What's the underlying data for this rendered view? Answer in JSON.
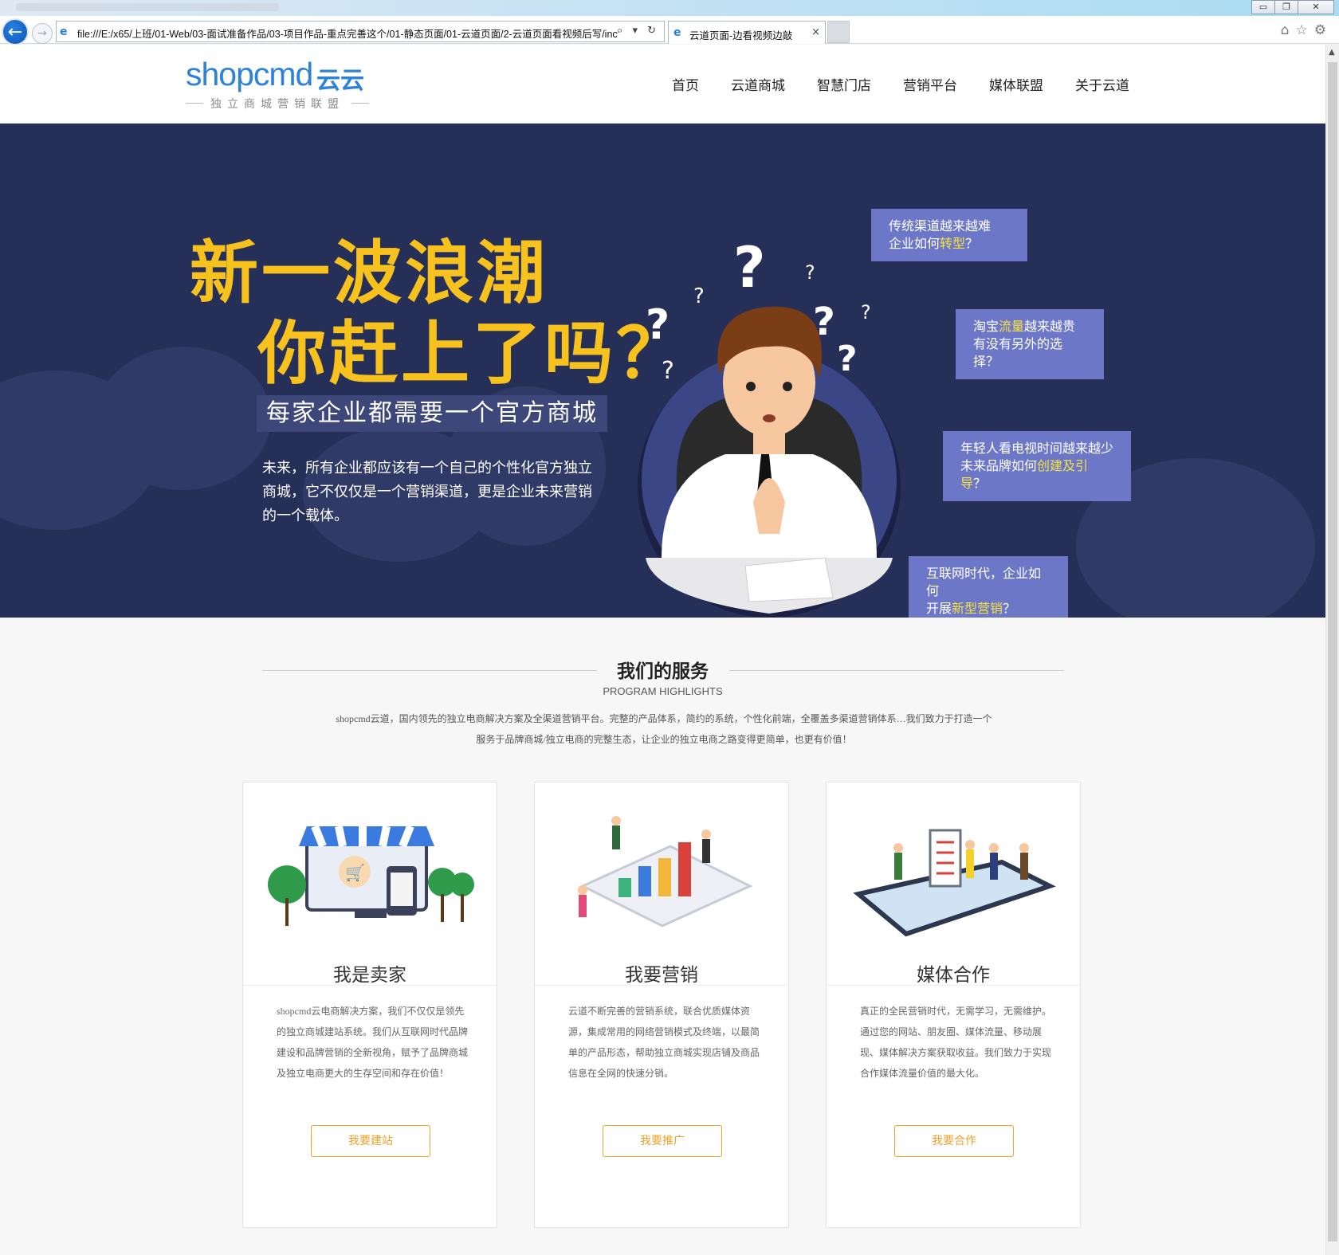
{
  "browser": {
    "address_url": "file:///E:/x65/上班/01-Web/03-面试准备作品/03-项目作品-重点完善这个/01-静态页面/01-云道页面/2-云道页面看视频后写/inc",
    "tab_title": "云道页面-边看视频边敲",
    "back_label": "←",
    "forward_label": "→",
    "address_tools": "⌕ ▾ ↻",
    "tab_close": "×",
    "minimize": "▭",
    "restore": "❐",
    "close": "✕",
    "home_icon": "⌂",
    "star_icon": "☆",
    "settings_icon": "⚙"
  },
  "header": {
    "logo_word": "shopcmd",
    "logo_cn": "云云",
    "logo_tagline": "独立商城营销联盟",
    "nav": [
      "首页",
      "云道商城",
      "智慧门店",
      "营销平台",
      "媒体联盟",
      "关于云道"
    ]
  },
  "hero": {
    "title_line1": "新一波浪潮",
    "title_line2": "你赶上了吗？",
    "subtitle": "每家企业都需要一个官方商城",
    "description": "未来，所有企业都应该有一个自己的个性化官方独立商城，它不仅仅是一个营销渠道，更是企业未来营销的一个载体。",
    "bubbles": [
      {
        "line1": "传统渠道越来越难",
        "pre": "企业如何",
        "hl": "转型",
        "post": "？"
      },
      {
        "line1_pre": "淘宝",
        "line1_hl": "流量",
        "line1_post": "越来越贵",
        "line2": "有没有另外的选择？"
      },
      {
        "line1": "年轻人看电视时间越来越少",
        "pre": "未来品牌如何",
        "hl": "创建及引导",
        "post": "？"
      },
      {
        "line1": "互联网时代，企业如何",
        "pre": "开展",
        "hl": "新型营销",
        "post": "？"
      }
    ]
  },
  "services": {
    "title": "我们的服务",
    "subtitle": "PROGRAM HIGHLIGHTS",
    "desc_line1": "shopcmd云道，国内领先的独立电商解决方案及全渠道营销平台。完整的产品体系，简约的系统，个性化前端，全覆盖多渠道营销体系…我们致力于打造一个",
    "desc_line2": "服务于品牌商城/独立电商的完整生态，让企业的独立电商之路变得更简单，也更有价值！",
    "cards": [
      {
        "name": "我是卖家",
        "body": "shopcmd云电商解决方案，我们不仅仅是领先的独立商城建站系统。我们从互联网时代品牌建设和品牌营销的全新视角，赋予了品牌商城及独立电商更大的生存空间和存在价值！",
        "button": "我要建站"
      },
      {
        "name": "我要营销",
        "body": "云道不断完善的营销系统，联合优质媒体资源，集成常用的网络营销模式及终端，以最简单的产品形态，帮助独立商城实现店铺及商品信息在全网的快速分销。",
        "button": "我要推广"
      },
      {
        "name": "媒体合作",
        "body": "真正的全民营销时代，无需学习，无需维护。通过您的网站、朋友圈、媒体流量、移动展现、媒体解决方案获取收益。我们致力于实现合作媒体流量价值的最大化。",
        "button": "我要合作"
      }
    ]
  },
  "colors": {
    "hero_bg": "#262f58",
    "title_yellow": "#f7c21e",
    "bubble_bg": "#6c78c7",
    "highlight": "#f7e23e",
    "brand_blue": "#2d82d9",
    "button_orange": "#f0a12c"
  }
}
